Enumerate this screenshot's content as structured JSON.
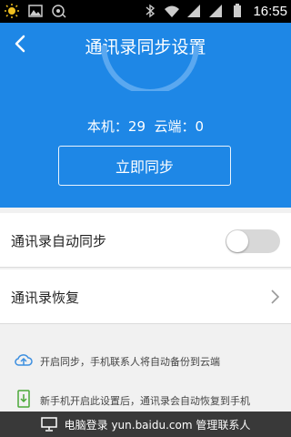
{
  "status_bar": {
    "time": "16:55"
  },
  "header": {
    "title": "通讯录同步设置",
    "counts": "本机：29  云端：0",
    "sync_button": "立即同步"
  },
  "settings": {
    "auto_sync_label": "通讯录自动同步",
    "auto_sync_enabled": false,
    "restore_label": "通讯录恢复"
  },
  "info": {
    "line1": "开启同步，手机联系人将自动备份到云端",
    "line2": "新手机开启此设置后，通讯录会自动恢复到手机"
  },
  "footer": {
    "text": "电脑登录 yun.baidu.com 管理联系人"
  },
  "colors": {
    "header_bg": "#1e87e6",
    "footer_bg": "#393939",
    "toggle_off": "#d8d8d8"
  }
}
